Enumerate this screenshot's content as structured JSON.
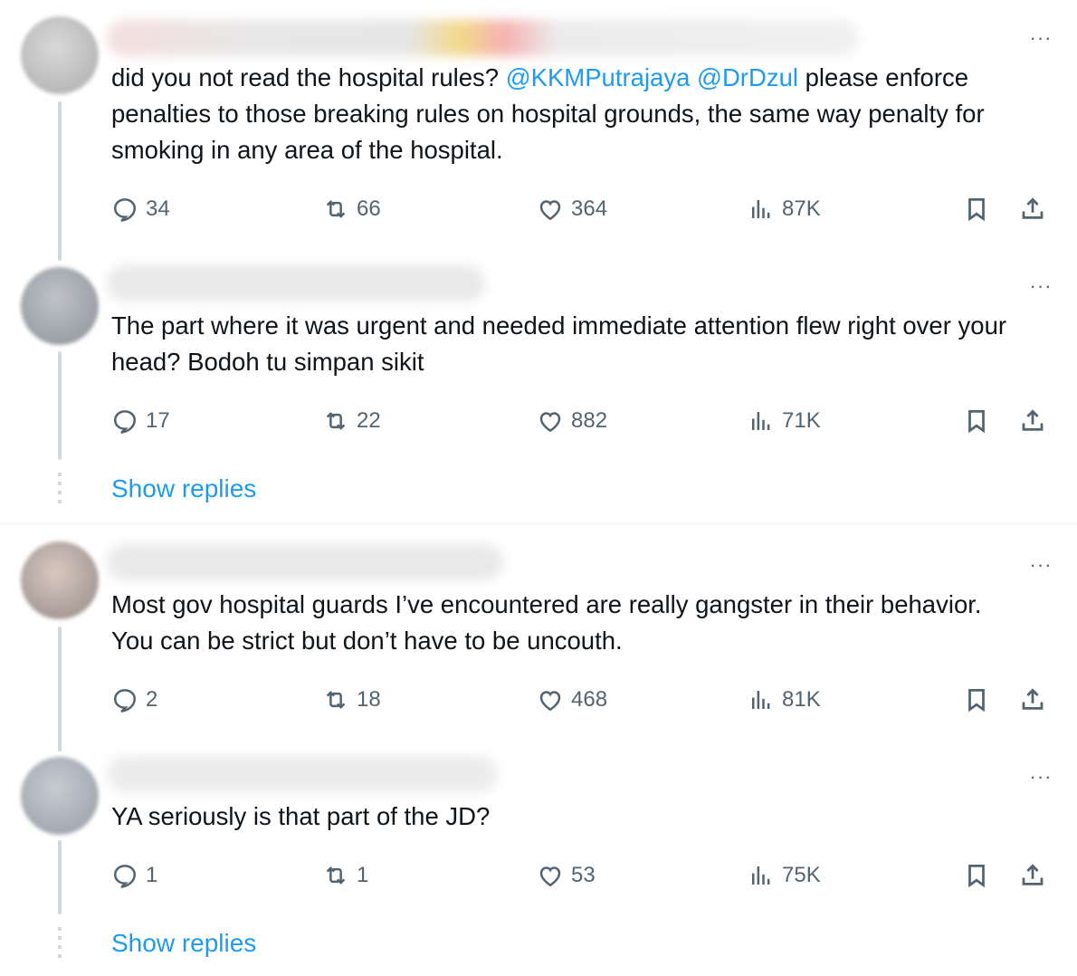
{
  "replies": [
    {
      "text_parts": [
        "did you not read the hospital rules? ",
        "@KKMPutrajaya",
        " ",
        "@DrDzul",
        "  please enforce penalties to those breaking rules on hospital grounds, the same way penalty for smoking in any area of the hospital."
      ],
      "stats": {
        "replies": "34",
        "reposts": "66",
        "likes": "364",
        "views": "87K"
      }
    },
    {
      "text": "The part where it was urgent and needed immediate attention flew right over your head? Bodoh tu simpan sikit",
      "stats": {
        "replies": "17",
        "reposts": "22",
        "likes": "882",
        "views": "71K"
      }
    },
    {
      "text": "Most gov hospital guards I’ve encountered are really gangster in their behavior. You can be strict but don’t have to be uncouth.",
      "stats": {
        "replies": "2",
        "reposts": "18",
        "likes": "468",
        "views": "81K"
      }
    },
    {
      "text": "YA seriously is that part of the JD?",
      "stats": {
        "replies": "1",
        "reposts": "1",
        "likes": "53",
        "views": "75K"
      }
    }
  ],
  "show_replies_label": "Show replies",
  "more_glyph": "···",
  "colors": {
    "accent": "#1d9bf0",
    "muted": "#536471",
    "line": "#cfd9de",
    "text": "#0f1419"
  },
  "icons": [
    "reply-icon",
    "repost-icon",
    "like-icon",
    "views-icon",
    "bookmark-icon",
    "share-icon",
    "more-icon"
  ]
}
